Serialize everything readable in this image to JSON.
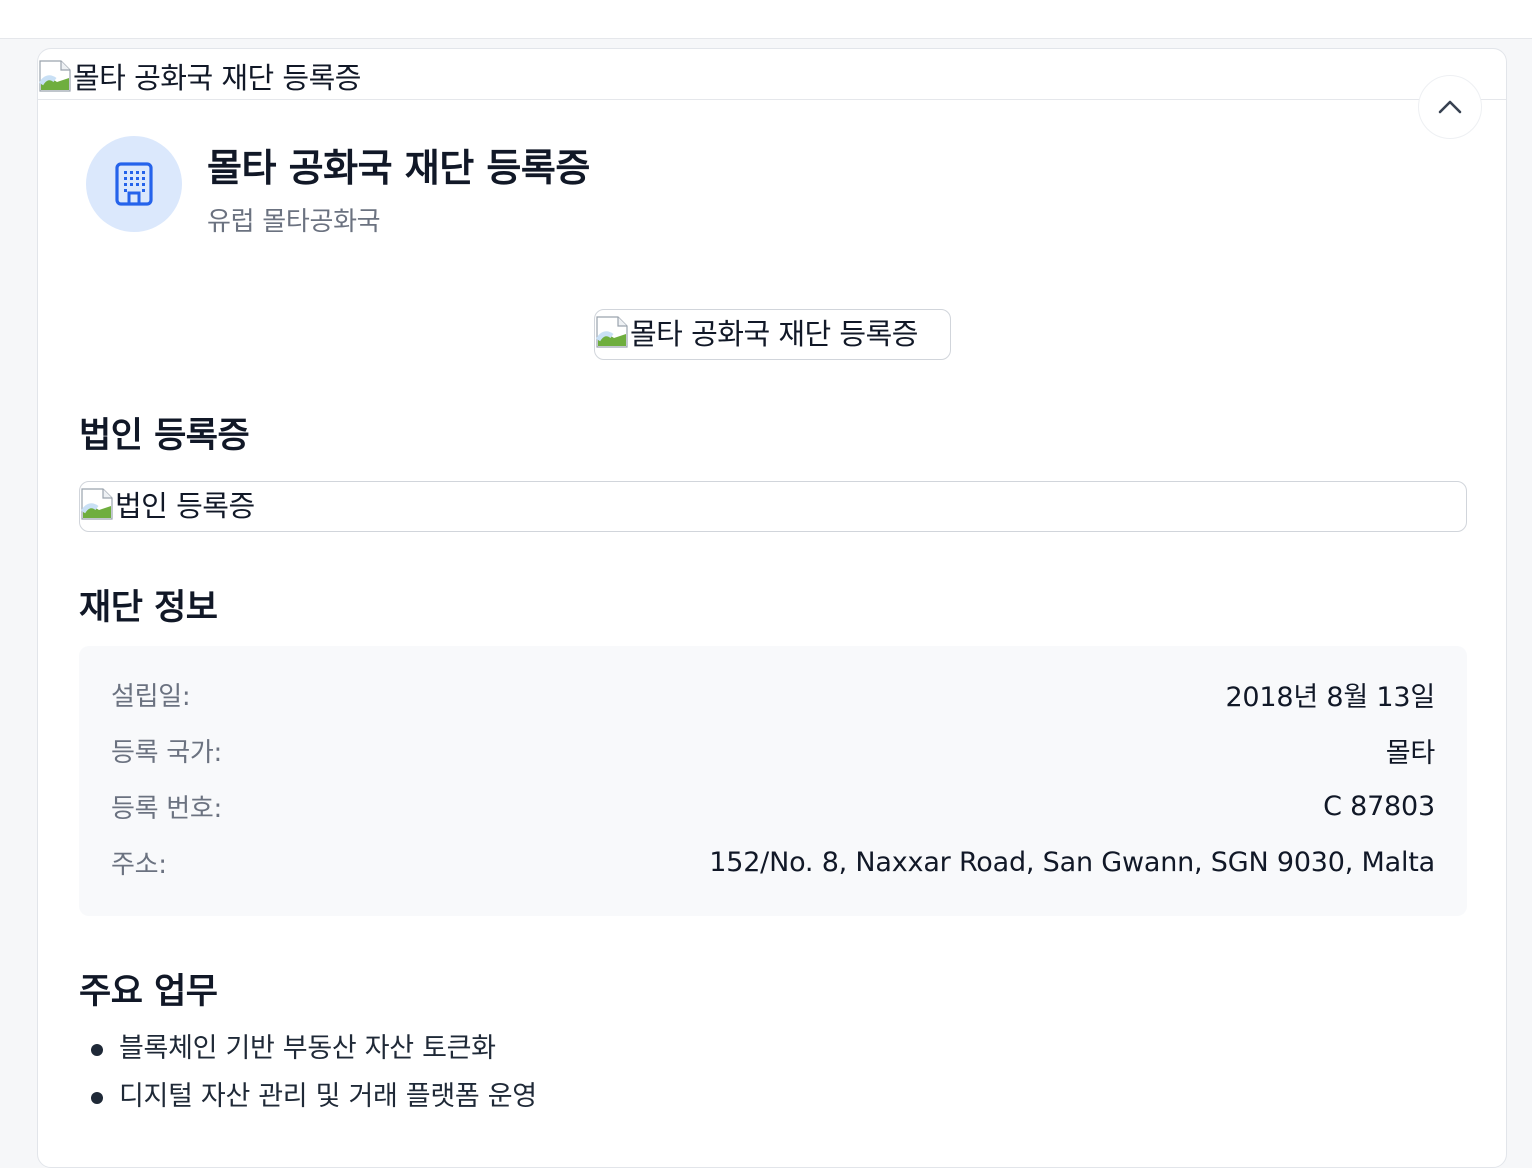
{
  "header": {
    "banner_alt": "몰타 공화국 재단 등록증"
  },
  "organization": {
    "name": "몰타 공화국 재단 등록증",
    "subtitle": "유럽 몰타공화국",
    "logo_alt": "몰타 공화국 재단 등록증",
    "avatar_icon": "building-icon"
  },
  "certificate_section": {
    "title": "법인 등록증",
    "image_alt": "법인 등록증"
  },
  "info_section": {
    "title": "재단 정보",
    "rows": [
      {
        "label": "설립일:",
        "value": "2018년 8월 13일"
      },
      {
        "label": "등록 국가:",
        "value": "몰타"
      },
      {
        "label": "등록 번호:",
        "value": "C 87803"
      },
      {
        "label": "주소:",
        "value": "152/No. 8, Naxxar Road, San Gwann, SGN 9030, Malta"
      }
    ]
  },
  "duties_section": {
    "title": "주요 업무",
    "items": [
      "블록체인 기반 부동산 자산 토큰화",
      "디지털 자산 관리 및 거래 플랫폼 운영"
    ]
  },
  "colors": {
    "accent": "#2563eb",
    "avatar_bg": "#dbe8fc",
    "info_bg": "#f8f9fb"
  }
}
